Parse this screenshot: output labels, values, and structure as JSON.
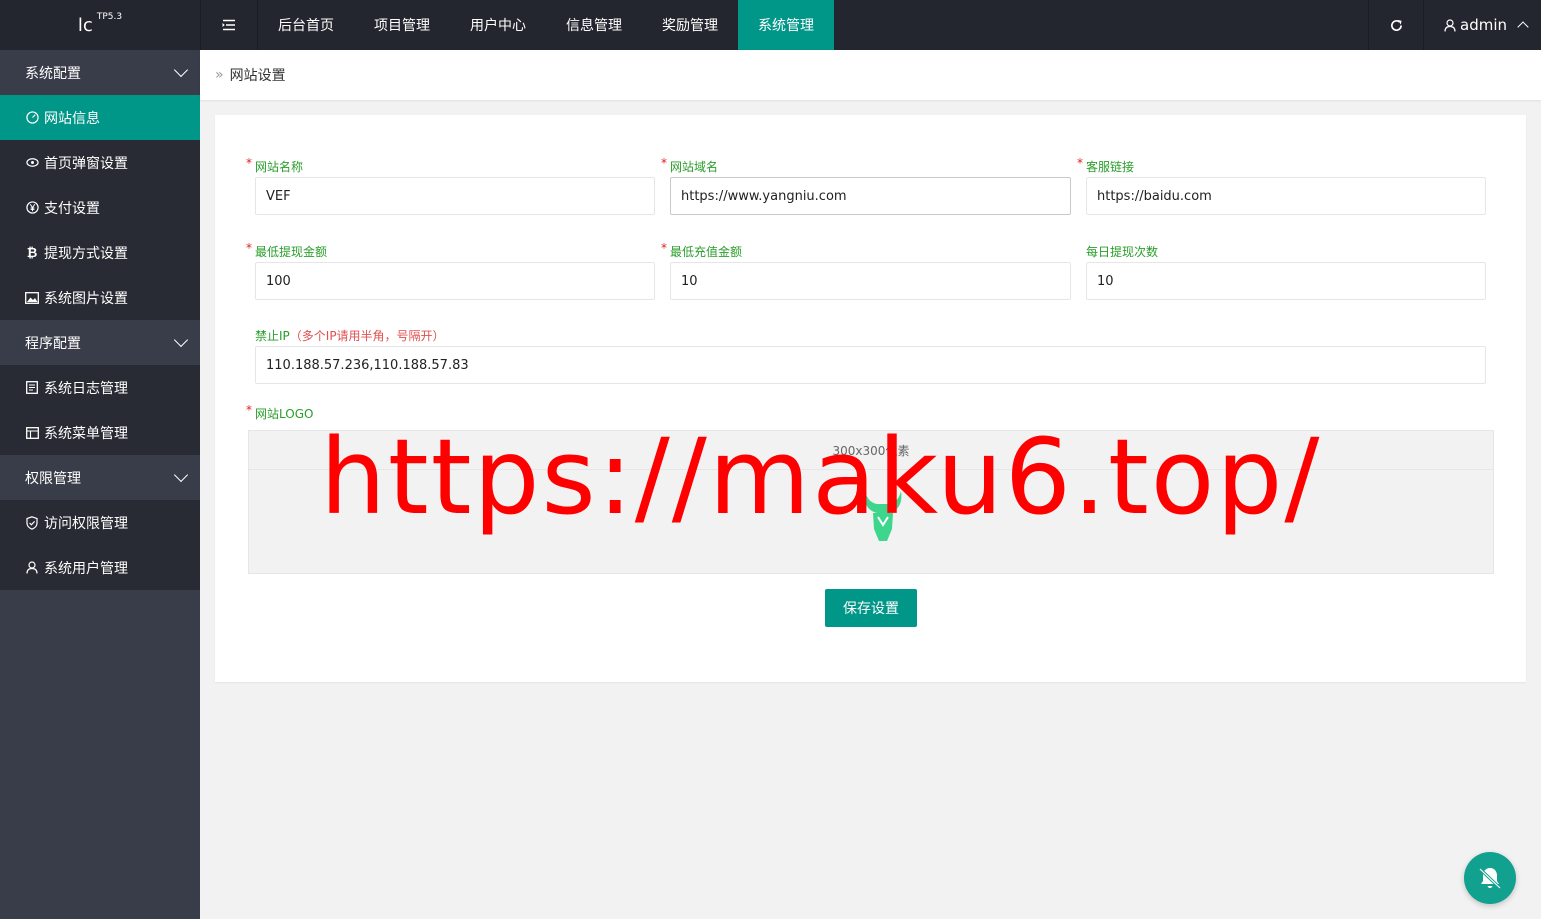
{
  "app": {
    "logo_text": "lc",
    "logo_version": "TP5.3",
    "accent": "#009688"
  },
  "topbar": {
    "tabs": [
      {
        "label": "后台首页",
        "active": false
      },
      {
        "label": "项目管理",
        "active": false
      },
      {
        "label": "用户中心",
        "active": false
      },
      {
        "label": "信息管理",
        "active": false
      },
      {
        "label": "奖励管理",
        "active": false
      },
      {
        "label": "系统管理",
        "active": true
      }
    ],
    "user": "admin"
  },
  "sidebar": {
    "groups": [
      {
        "label": "系统配置",
        "items": [
          {
            "label": "网站信息",
            "icon": "dashboard-icon",
            "active": true
          },
          {
            "label": "首页弹窗设置",
            "icon": "eye-icon",
            "active": false
          },
          {
            "label": "支付设置",
            "icon": "yen-icon",
            "active": false
          },
          {
            "label": "提现方式设置",
            "icon": "bitcoin-icon",
            "active": false
          },
          {
            "label": "系统图片设置",
            "icon": "image-icon",
            "active": false
          }
        ]
      },
      {
        "label": "程序配置",
        "items": [
          {
            "label": "系统日志管理",
            "icon": "log-icon",
            "active": false
          },
          {
            "label": "系统菜单管理",
            "icon": "menu-table-icon",
            "active": false
          }
        ]
      },
      {
        "label": "权限管理",
        "items": [
          {
            "label": "访问权限管理",
            "icon": "shield-icon",
            "active": false
          },
          {
            "label": "系统用户管理",
            "icon": "user-icon",
            "active": false
          }
        ]
      }
    ]
  },
  "breadcrumb": {
    "separator": "»",
    "current": "网站设置"
  },
  "form": {
    "site_name": {
      "label": "网站名称",
      "value": "VEF",
      "required": true
    },
    "site_domain": {
      "label": "网站域名",
      "value": "https://www.yangniu.com",
      "required": true
    },
    "service_link": {
      "label": "客服链接",
      "value": "https://baidu.com",
      "required": true
    },
    "min_withdraw": {
      "label": "最低提现金额",
      "value": "100",
      "required": true
    },
    "min_recharge": {
      "label": "最低充值金额",
      "value": "10",
      "required": true
    },
    "daily_withdraw": {
      "label": "每日提现次数",
      "value": "10",
      "required": false
    },
    "banned_ip": {
      "label": "禁止IP",
      "hint": "（多个IP请用半角，号隔开）",
      "value": "110.188.57.236,110.188.57.83"
    },
    "site_logo": {
      "label": "网站LOGO",
      "size_hint": "300x300像素",
      "required": true
    },
    "save_label": "保存设置"
  },
  "watermark": "https://maku6.top/"
}
